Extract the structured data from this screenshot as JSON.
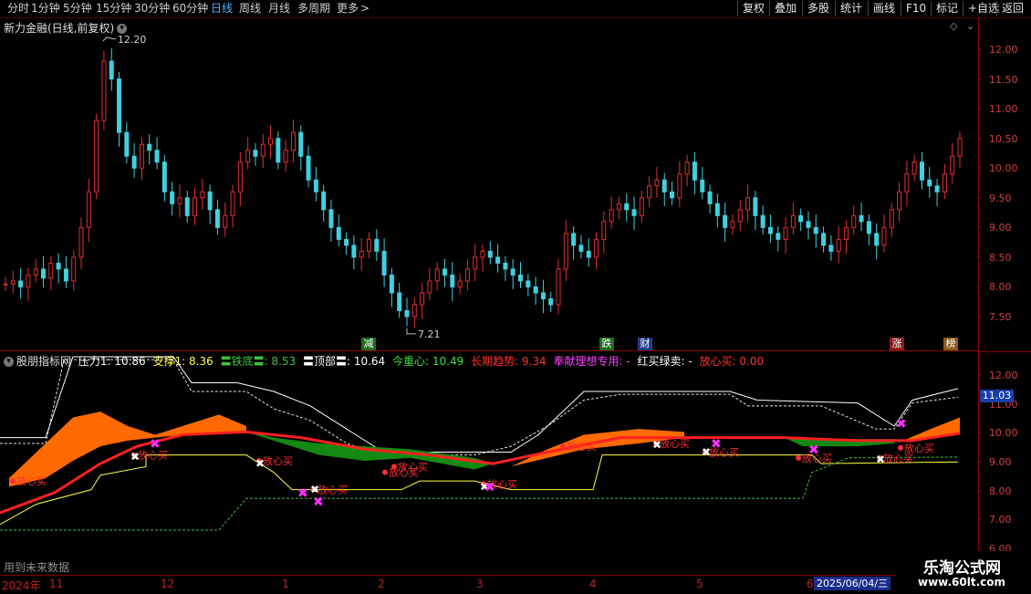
{
  "toolbar": {
    "periods": [
      "分时",
      "1分钟",
      "5分钟",
      "15分钟",
      "30分钟",
      "60分钟",
      "日线",
      "周线",
      "月线",
      "多周期",
      "更多"
    ],
    "active_period": "日线",
    "more_arrow": ">",
    "right_buttons": [
      "复权",
      "叠加",
      "多股",
      "统计",
      "画线",
      "F10",
      "标记",
      "+自选",
      "返回"
    ]
  },
  "main_chart": {
    "title": "新力金融(日线,前复权)",
    "high_label": "12.20",
    "low_label": "7.21",
    "y_ticks": [
      "12.00",
      "11.50",
      "11.00",
      "10.50",
      "10.00",
      "9.50",
      "9.00",
      "8.50",
      "8.00",
      "7.50"
    ],
    "event_tags": [
      {
        "text": "减",
        "color": "#2a8a2a"
      },
      {
        "text": "跌",
        "color": "#2a8a2a"
      },
      {
        "text": "财",
        "color": "#2a4aa0"
      },
      {
        "text": "涨",
        "color": "#b02020"
      },
      {
        "text": "榜",
        "color": "#c08020"
      }
    ]
  },
  "indicator": {
    "name": "股朋指标网",
    "fields": [
      {
        "label": "压力1: 10.86",
        "color": "#ffffff"
      },
      {
        "label": "支撑1: 8.36",
        "color": "#ffff40"
      },
      {
        "label": "〓铁底〓: 8.53",
        "color": "#40c040"
      },
      {
        "label": "〓顶部〓: 10.64",
        "color": "#ffffff"
      },
      {
        "label": "今重心: 10.49",
        "color": "#40e040"
      },
      {
        "label": "长期趋势: 9.34",
        "color": "#ff3030"
      },
      {
        "label": "奉献理想专用: -",
        "color": "#ff40ff"
      },
      {
        "label": "红买绿卖: -",
        "color": "#ffffff"
      },
      {
        "label": "放心买: 0.00",
        "color": "#ff3030"
      }
    ],
    "y_ticks": [
      "12.00",
      "11.00",
      "10.00",
      "9.00",
      "8.00",
      "7.00",
      "6.00"
    ],
    "current_value": "11.03",
    "buy_label": "放心买",
    "footnote": "用到未来数据"
  },
  "date_axis": {
    "labels": [
      "2024年",
      "11",
      "12",
      "1",
      "2",
      "3",
      "4",
      "5",
      "6"
    ],
    "current_date": "2025/06/04/三"
  },
  "watermark": {
    "name": "乐淘公式网",
    "url": "www.60lt.com"
  },
  "colors": {
    "up": "#e03030",
    "down": "#40d0e0",
    "axis": "#8a0000",
    "trend": "#ff2020",
    "cloud_up": "#ff6a00",
    "cloud_down": "#138a13"
  }
}
